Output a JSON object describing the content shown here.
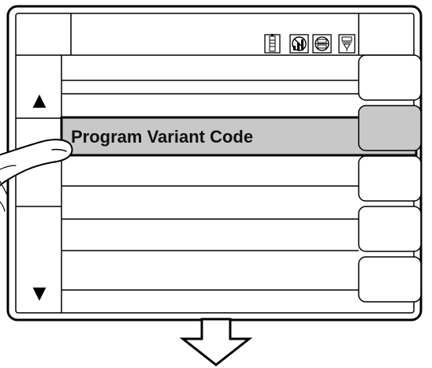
{
  "menu": {
    "highlighted_item_label": "Program Variant Code",
    "scroll_up_symbol": "▲",
    "scroll_down_symbol": "▼",
    "selection_color": "#c8c8c8"
  },
  "status_icons": [
    {
      "name": "battery-icon"
    },
    {
      "name": "no-signal-icon"
    },
    {
      "name": "network-icon"
    },
    {
      "name": "download-icon"
    }
  ],
  "softkeys": [
    {
      "name": "softkey-1"
    },
    {
      "name": "softkey-2"
    },
    {
      "name": "softkey-3"
    },
    {
      "name": "softkey-4"
    },
    {
      "name": "softkey-5"
    }
  ],
  "annotations": {
    "pointing_hand": "hand-pointer-icon",
    "scroll_hint": "down-arrow-outline-icon"
  }
}
